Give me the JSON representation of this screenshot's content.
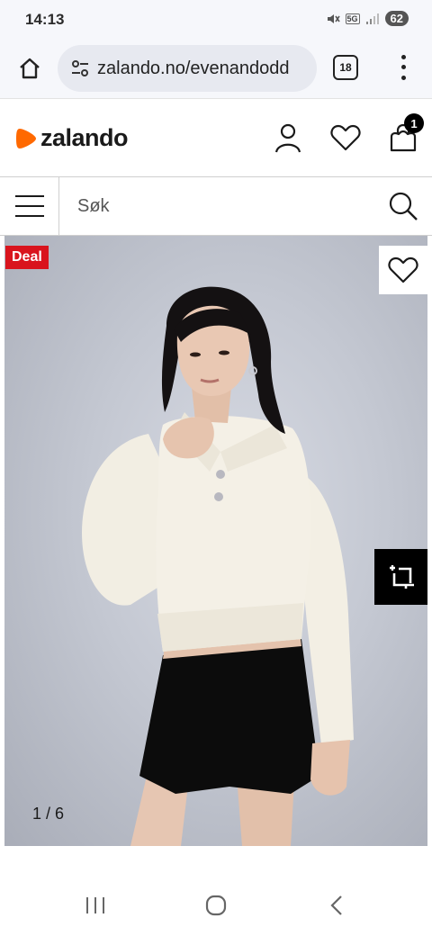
{
  "status_bar": {
    "time": "14:13",
    "network": "5G",
    "battery": "62"
  },
  "browser": {
    "url": "zalando.no/evenandodd",
    "tab_count": "18"
  },
  "site": {
    "brand": "zalando",
    "cart_count": "1"
  },
  "search": {
    "placeholder": "Søk"
  },
  "product": {
    "badge": "Deal",
    "image_counter": "1 / 6"
  },
  "colors": {
    "brand_orange": "#ff6900",
    "deal_red": "#d9141d"
  }
}
